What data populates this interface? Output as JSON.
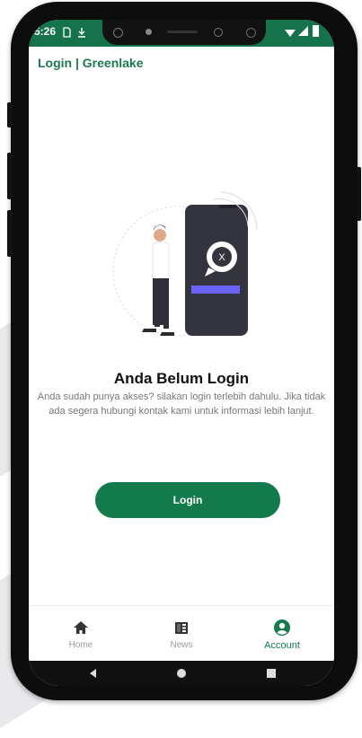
{
  "status_bar": {
    "time": "5:26",
    "icons": [
      "sim-icon",
      "download-icon",
      "wifi-icon",
      "signal-icon",
      "battery-icon"
    ]
  },
  "app_bar": {
    "title": "Login | Greenlake"
  },
  "illustration": {
    "badge_text": "X"
  },
  "empty_state": {
    "heading": "Anda Belum Login",
    "description": "Anda sudah punya akses? silakan login terlebih dahulu. Jika tidak ada segera hubungi kontak kami untuk informasi lebih lanjut."
  },
  "login_button": {
    "label": "Login"
  },
  "bottom_nav": {
    "items": [
      {
        "label": "Home",
        "icon": "home-icon"
      },
      {
        "label": "News",
        "icon": "news-icon"
      },
      {
        "label": "Account",
        "icon": "account-icon",
        "active": true
      }
    ]
  },
  "colors": {
    "brand": "#137a4c",
    "status_bar": "#14734a",
    "illustration_dark": "#34343f",
    "illustration_accent": "#6c63ff"
  }
}
